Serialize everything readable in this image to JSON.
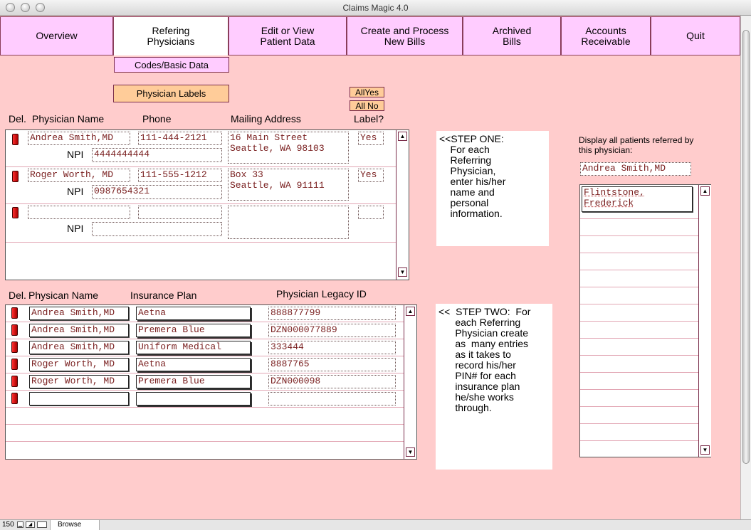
{
  "window": {
    "title": "Claims Magic 4.0"
  },
  "nav": {
    "overview": "Overview",
    "refering": "Refering\nPhysicians",
    "edit_patient": "Edit or View\nPatient Data",
    "create_bills": "Create  and Process\nNew Bills",
    "archived": "Archived\nBills",
    "receivable": "Accounts\nReceivable",
    "quit": "Quit"
  },
  "buttons": {
    "codes": "Codes/Basic Data",
    "labels": "Physician Labels",
    "all_yes": "AllYes",
    "all_no": "All No"
  },
  "physicians_header": {
    "del": "Del.",
    "name": "Physician Name",
    "phone": "Phone",
    "address": "Mailing Address",
    "label": "Label?"
  },
  "physicians": [
    {
      "name": "Andrea Smith,MD",
      "phone": "111-444-2121",
      "address": "16 Main Street\nSeattle, WA 98103",
      "label": "Yes",
      "npi_label": "NPI",
      "npi": "4444444444"
    },
    {
      "name": "Roger Worth, MD",
      "phone": "111-555-1212",
      "address": "Box 33\nSeattle, WA 91111",
      "label": "Yes",
      "npi_label": "NPI",
      "npi": "0987654321"
    },
    {
      "name": "",
      "phone": "",
      "address": "",
      "label": "",
      "npi_label": "NPI",
      "npi": ""
    }
  ],
  "plans_header": {
    "del": "Del.",
    "name": "Physican Name",
    "plan": "Insurance Plan",
    "legacy": "Physician Legacy ID"
  },
  "plans": [
    {
      "name": "Andrea Smith,MD",
      "plan": "Aetna",
      "legacy": "888877799"
    },
    {
      "name": "Andrea Smith,MD",
      "plan": "Premera Blue",
      "legacy": "DZN000077889"
    },
    {
      "name": "Andrea Smith,MD",
      "plan": "Uniform Medical",
      "legacy": "333444"
    },
    {
      "name": "Roger Worth, MD",
      "plan": "Aetna",
      "legacy": "8887765"
    },
    {
      "name": "Roger Worth, MD",
      "plan": "Premera Blue",
      "legacy": "DZN000098"
    },
    {
      "name": "",
      "plan": "",
      "legacy": ""
    }
  ],
  "steps": {
    "one": "<<STEP ONE:\n    For each\n    Referring\n    Physician,\n    enter his/her\n    name and\n    personal\n    information.",
    "two": "<<  STEP TWO:  For\n      each Referring\n      Physician create\n      as  many entries\n      as it takes to\n      record his/her\n      PIN# for each\n      insurance plan\n      he/she works\n      through."
  },
  "referred": {
    "label": "Display all patients referred by\nthis physician:",
    "physician": "Andrea Smith,MD",
    "patients": [
      "Flintstone,\nFrederick"
    ]
  },
  "status": {
    "zoom": "150",
    "mode": "Browse"
  }
}
